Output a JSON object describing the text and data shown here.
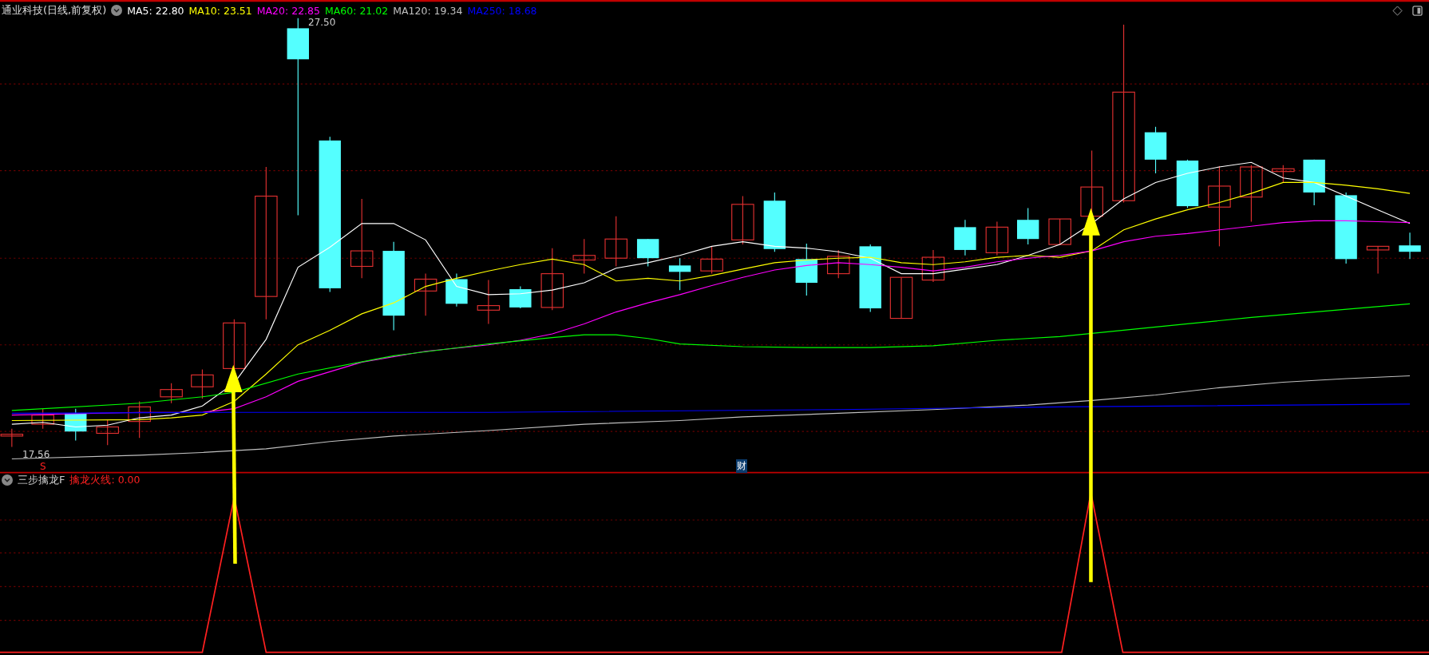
{
  "header": {
    "title": "通业科技(日线,前复权)",
    "averages": [
      {
        "text": "MA5: 22.80",
        "color": "#ffffff"
      },
      {
        "text": "MA10: 23.51",
        "color": "#ffff00"
      },
      {
        "text": "MA20: 22.85",
        "color": "#ff00ff"
      },
      {
        "text": "MA60: 21.02",
        "color": "#00ff00"
      },
      {
        "text": "MA120: 19.34",
        "color": "#c0c0c0"
      },
      {
        "text": "MA250: 18.68",
        "color": "#0000ff"
      }
    ]
  },
  "price_chart": {
    "high_label": "27.50",
    "low_label": "17.56",
    "signal_mark": "S",
    "finance_mark": "财"
  },
  "indicator": {
    "name": "三步擒龙F",
    "value_text": "擒龙火线: 0.00"
  }
}
